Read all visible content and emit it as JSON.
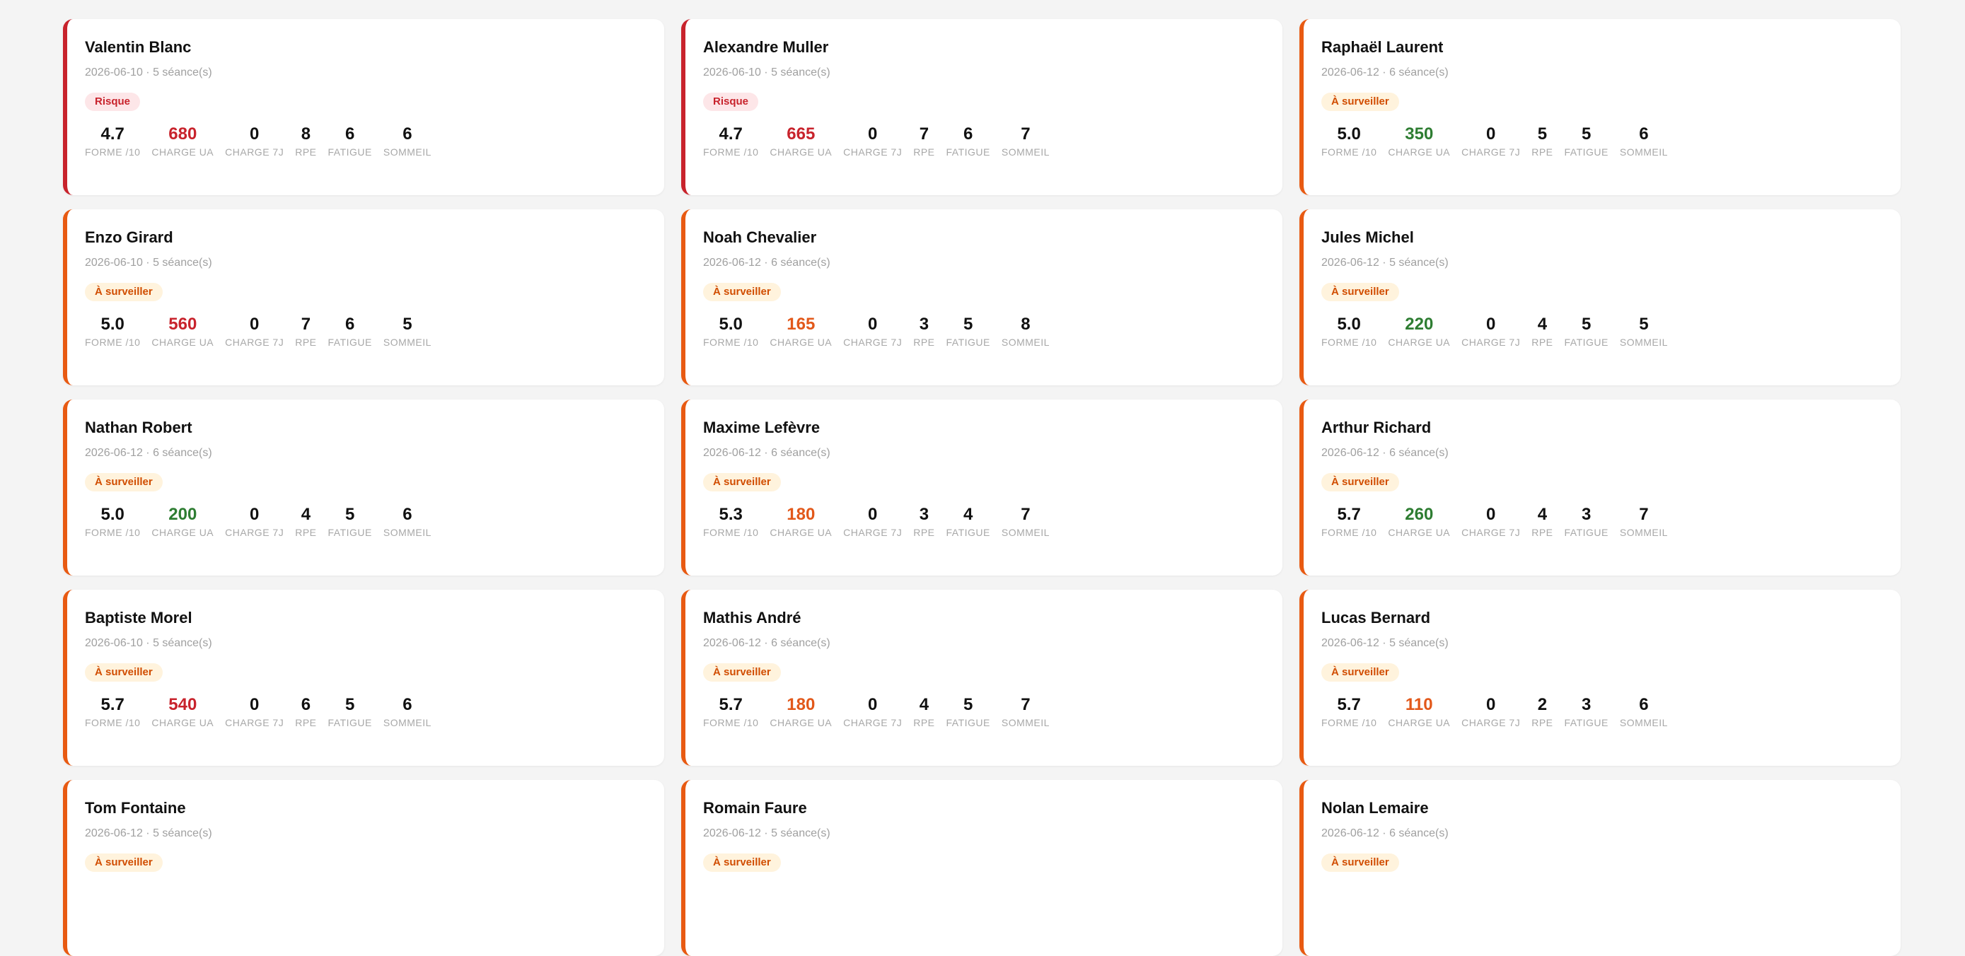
{
  "labels": {
    "forme": "FORME /10",
    "charge_ua": "CHARGE UA",
    "charge_7j": "CHARGE 7J",
    "rpe": "RPE",
    "fatigue": "FATIGUE",
    "sommeil": "SOMMEIL"
  },
  "colors": {
    "risk": "#c8232c",
    "watch": "#e85a12",
    "charge_high": "#c8232c",
    "charge_mid": "#e2581a",
    "charge_low": "#2e7d32"
  },
  "players": [
    {
      "name": "Valentin Blanc",
      "meta": "2026-06-10 · 5 séance(s)",
      "status": "Risque",
      "forme": "4.7",
      "charge_ua": "680",
      "charge_7j": "0",
      "rpe": "8",
      "fatigue": "6",
      "sommeil": "6"
    },
    {
      "name": "Alexandre Muller",
      "meta": "2026-06-10 · 5 séance(s)",
      "status": "Risque",
      "forme": "4.7",
      "charge_ua": "665",
      "charge_7j": "0",
      "rpe": "7",
      "fatigue": "6",
      "sommeil": "7"
    },
    {
      "name": "Raphaël Laurent",
      "meta": "2026-06-12 · 6 séance(s)",
      "status": "À surveiller",
      "forme": "5.0",
      "charge_ua": "350",
      "charge_7j": "0",
      "rpe": "5",
      "fatigue": "5",
      "sommeil": "6"
    },
    {
      "name": "Enzo Girard",
      "meta": "2026-06-10 · 5 séance(s)",
      "status": "À surveiller",
      "forme": "5.0",
      "charge_ua": "560",
      "charge_7j": "0",
      "rpe": "7",
      "fatigue": "6",
      "sommeil": "5"
    },
    {
      "name": "Noah Chevalier",
      "meta": "2026-06-12 · 6 séance(s)",
      "status": "À surveiller",
      "forme": "5.0",
      "charge_ua": "165",
      "charge_7j": "0",
      "rpe": "3",
      "fatigue": "5",
      "sommeil": "8"
    },
    {
      "name": "Jules Michel",
      "meta": "2026-06-12 · 5 séance(s)",
      "status": "À surveiller",
      "forme": "5.0",
      "charge_ua": "220",
      "charge_7j": "0",
      "rpe": "4",
      "fatigue": "5",
      "sommeil": "5"
    },
    {
      "name": "Nathan Robert",
      "meta": "2026-06-12 · 6 séance(s)",
      "status": "À surveiller",
      "forme": "5.0",
      "charge_ua": "200",
      "charge_7j": "0",
      "rpe": "4",
      "fatigue": "5",
      "sommeil": "6"
    },
    {
      "name": "Maxime Lefèvre",
      "meta": "2026-06-12 · 6 séance(s)",
      "status": "À surveiller",
      "forme": "5.3",
      "charge_ua": "180",
      "charge_7j": "0",
      "rpe": "3",
      "fatigue": "4",
      "sommeil": "7"
    },
    {
      "name": "Arthur Richard",
      "meta": "2026-06-12 · 6 séance(s)",
      "status": "À surveiller",
      "forme": "5.7",
      "charge_ua": "260",
      "charge_7j": "0",
      "rpe": "4",
      "fatigue": "3",
      "sommeil": "7"
    },
    {
      "name": "Baptiste Morel",
      "meta": "2026-06-10 · 5 séance(s)",
      "status": "À surveiller",
      "forme": "5.7",
      "charge_ua": "540",
      "charge_7j": "0",
      "rpe": "6",
      "fatigue": "5",
      "sommeil": "6"
    },
    {
      "name": "Mathis André",
      "meta": "2026-06-12 · 6 séance(s)",
      "status": "À surveiller",
      "forme": "5.7",
      "charge_ua": "180",
      "charge_7j": "0",
      "rpe": "4",
      "fatigue": "5",
      "sommeil": "7"
    },
    {
      "name": "Lucas Bernard",
      "meta": "2026-06-12 · 5 séance(s)",
      "status": "À surveiller",
      "forme": "5.7",
      "charge_ua": "110",
      "charge_7j": "0",
      "rpe": "2",
      "fatigue": "3",
      "sommeil": "6"
    },
    {
      "name": "Tom Fontaine",
      "meta": "2026-06-12 · 5 séance(s)",
      "status": "À surveiller"
    },
    {
      "name": "Romain Faure",
      "meta": "2026-06-12 · 5 séance(s)",
      "status": "À surveiller"
    },
    {
      "name": "Nolan Lemaire",
      "meta": "2026-06-12 · 6 séance(s)",
      "status": "À surveiller"
    }
  ]
}
